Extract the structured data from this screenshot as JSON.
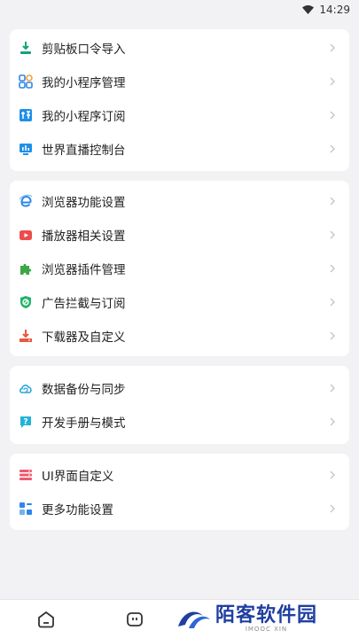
{
  "status": {
    "time": "14:29"
  },
  "groups": [
    {
      "items": [
        {
          "label": "剪贴板口令导入",
          "icon": "import-icon",
          "color": "#12a37a"
        },
        {
          "label": "我的小程序管理",
          "icon": "apps-icon",
          "color": "#2f86e6"
        },
        {
          "label": "我的小程序订阅",
          "icon": "subscribe-icon",
          "color": "#1e90e8"
        },
        {
          "label": "世界直播控制台",
          "icon": "live-console-icon",
          "color": "#1e90e8"
        }
      ]
    },
    {
      "items": [
        {
          "label": "浏览器功能设置",
          "icon": "browser-icon",
          "color": "#2f86e6"
        },
        {
          "label": "播放器相关设置",
          "icon": "play-icon",
          "color": "#ee4b4b"
        },
        {
          "label": "浏览器插件管理",
          "icon": "puzzle-icon",
          "color": "#3aa844"
        },
        {
          "label": "广告拦截与订阅",
          "icon": "shield-icon",
          "color": "#22b36a"
        },
        {
          "label": "下载器及自定义",
          "icon": "download-icon",
          "color": "#e9573f"
        }
      ]
    },
    {
      "items": [
        {
          "label": "数据备份与同步",
          "icon": "cloud-sync-icon",
          "color": "#2aa6d9"
        },
        {
          "label": "开发手册与模式",
          "icon": "help-icon",
          "color": "#24b2d8"
        }
      ]
    },
    {
      "items": [
        {
          "label": "UI界面自定义",
          "icon": "layers-icon",
          "color": "#ee5a6e"
        },
        {
          "label": "更多功能设置",
          "icon": "grid-icon",
          "color": "#2f86e6"
        }
      ]
    }
  ],
  "tabbar": [
    {
      "icon": "home-icon"
    },
    {
      "icon": "message-icon"
    }
  ],
  "watermark": {
    "title": "陌客软件园",
    "subtitle": "IMOOC XIN"
  }
}
